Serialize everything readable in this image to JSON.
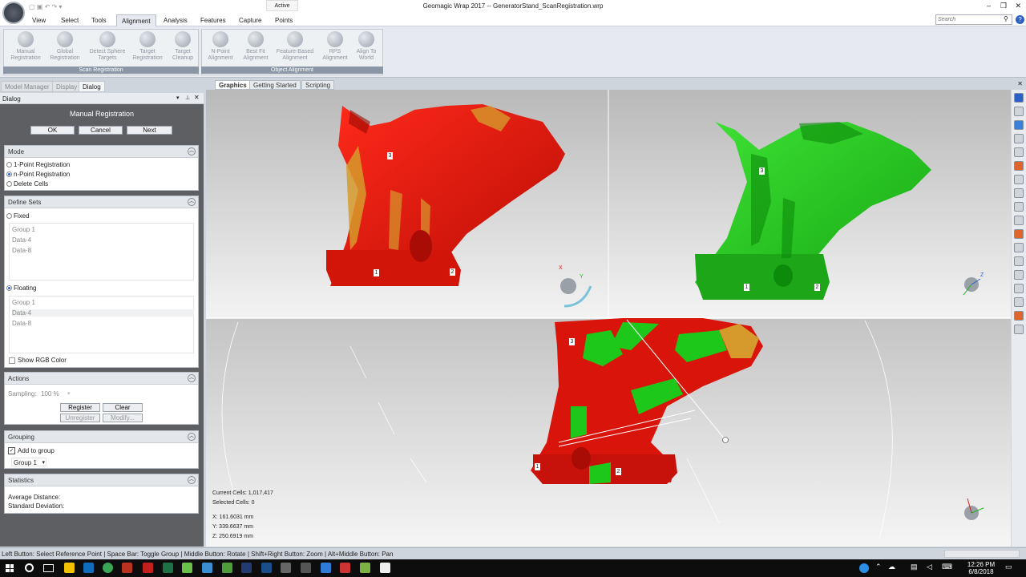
{
  "window": {
    "title": "Geomagic Wrap 2017 -- GeneratorStand_ScanRegistration.wrp",
    "active_label": "Active"
  },
  "ribbon": {
    "tabs": [
      "View",
      "Select",
      "Tools",
      "Alignment",
      "Analysis",
      "Features",
      "Capture",
      "Points"
    ],
    "active_tab": "Alignment",
    "search_placeholder": "Search",
    "groups": [
      {
        "label": "Scan Registration",
        "buttons": [
          [
            "Manual",
            "Registration"
          ],
          [
            "Global",
            "Registration"
          ],
          [
            "Detect Sphere",
            "Targets"
          ],
          [
            "Target",
            "Registration"
          ],
          [
            "Target",
            "Cleanup"
          ]
        ]
      },
      {
        "label": "Object Alignment",
        "buttons": [
          [
            "N-Point",
            "Alignment"
          ],
          [
            "Best Fit",
            "Alignment"
          ],
          [
            "Feature-Based",
            "Alignment"
          ],
          [
            "RPS",
            "Alignment"
          ],
          [
            "Align To",
            "World"
          ]
        ]
      }
    ]
  },
  "panel_tabs": [
    "Model Manager",
    "Display",
    "Dialog"
  ],
  "dialog": {
    "header": "Dialog",
    "title": "Manual Registration",
    "buttons": {
      "ok": "OK",
      "cancel": "Cancel",
      "next": "Next"
    },
    "mode": {
      "title": "Mode",
      "options": [
        "1-Point Registration",
        "n-Point Registration",
        "Delete Cells"
      ],
      "selected": "n-Point Registration"
    },
    "define_sets": {
      "title": "Define Sets",
      "fixed_label": "Fixed",
      "fixed_items": [
        "Group 1",
        "Data-4",
        "Data-8"
      ],
      "floating_label": "Floating",
      "floating_items": [
        "Group 1",
        "Data-4",
        "Data-8"
      ],
      "show_rgb": "Show RGB Color"
    },
    "actions": {
      "title": "Actions",
      "sampling_label": "Sampling:",
      "sampling_value": "100 %",
      "register": "Register",
      "clear": "Clear",
      "unregister": "Unregister",
      "modify": "Modify..."
    },
    "grouping": {
      "title": "Grouping",
      "add_to_group": "Add to group",
      "group_value": "Group 1"
    },
    "statistics": {
      "title": "Statistics",
      "avg_distance": "Average Distance:",
      "std_deviation": "Standard Deviation:"
    }
  },
  "view_tabs": [
    "Graphics",
    "Getting Started",
    "Scripting"
  ],
  "viewport": {
    "current_cells": "Current Cells: 1,017,417",
    "selected_cells": "Selected Cells: 0",
    "coords": [
      "X: 161.6031 mm",
      "Y: 339.6637 mm",
      "Z: 250.6919 mm"
    ],
    "markers_fixed": [
      "3",
      "1",
      "2"
    ],
    "markers_floating": [
      "3",
      "1",
      "2"
    ],
    "markers_result": [
      "3",
      "1",
      "2"
    ],
    "axis_labels": [
      "X",
      "Y",
      "Z"
    ]
  },
  "statusbar": {
    "text": "Left Button: Select Reference Point | Space Bar: Toggle Group | Middle Button: Rotate | Shift+Right Button: Zoom | Alt+Middle Button: Pan"
  },
  "taskbar": {
    "time": "12:26 PM",
    "date": "6/8/2018"
  },
  "colors": {
    "fixed": "#e11b10",
    "floating": "#22c81d",
    "gold": "#d69a2c"
  }
}
